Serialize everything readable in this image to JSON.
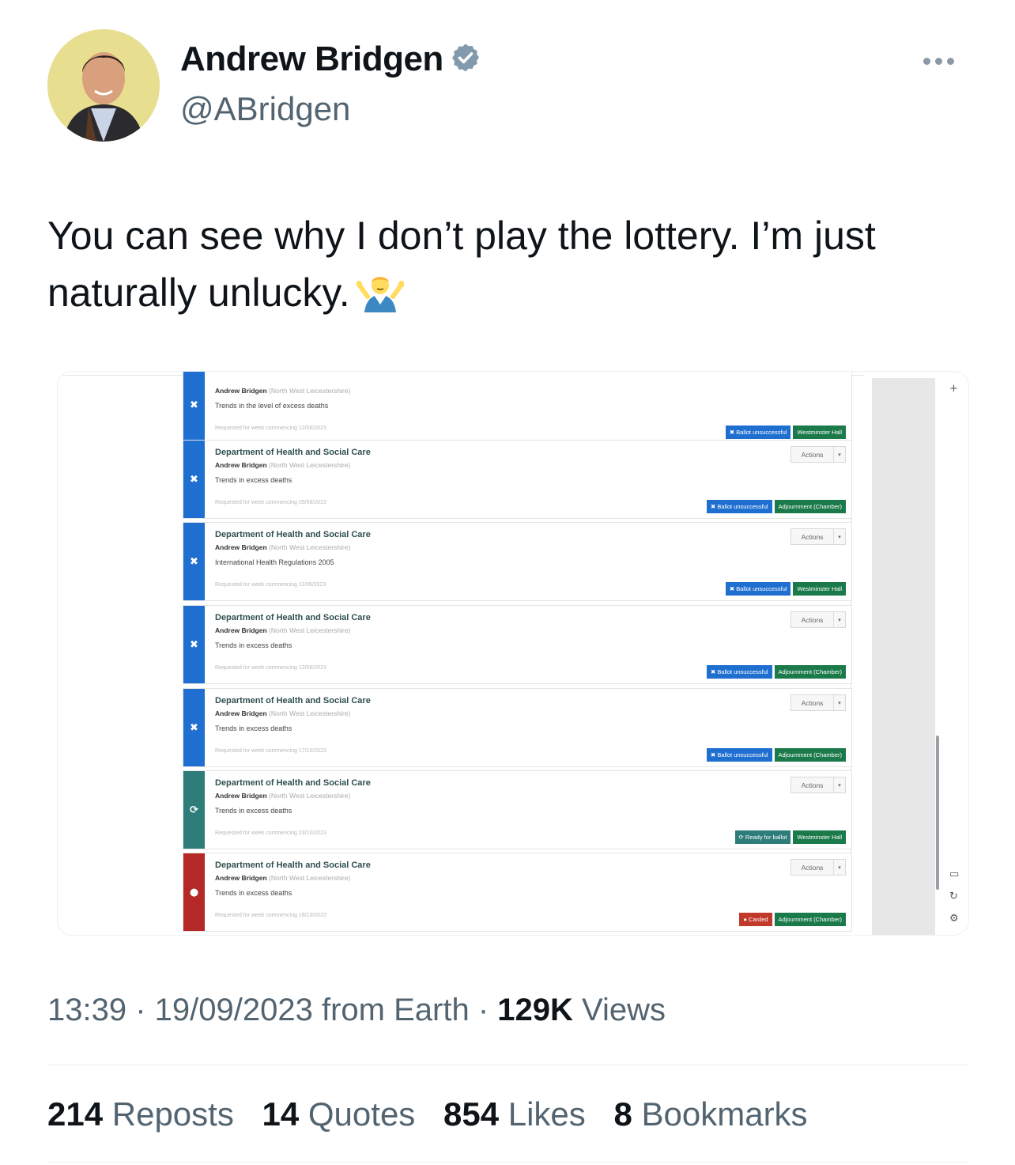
{
  "author": {
    "name": "Andrew Bridgen",
    "handle": "@ABridgen"
  },
  "tweet": {
    "text": "You can see why I don’t play the lottery. I’m just naturally unlucky."
  },
  "screenshot": {
    "cards": [
      {
        "dept": "",
        "mp": "Andrew Bridgen",
        "constituency": "(North West Leicestershire)",
        "topic": "Trends in the level of excess deaths",
        "requested": "Requested for week commencing 12/06/2023",
        "status_icon": "✖",
        "status": "Ballot unsuccessful",
        "venue": "Westminster Hall",
        "stripe_color": "#1f6fd1",
        "status_color": "#1f6fd1",
        "venue_color": "#1b7a4a",
        "actions": ""
      },
      {
        "dept": "Department of Health and Social Care",
        "mp": "Andrew Bridgen",
        "constituency": "(North West Leicestershire)",
        "topic": "Trends in excess deaths",
        "requested": "Requested for week commencing 05/06/2023",
        "status_icon": "✖",
        "status": "Ballot unsuccessful",
        "venue": "Adjournment (Chamber)",
        "stripe_color": "#1f6fd1",
        "status_color": "#1f6fd1",
        "venue_color": "#1b7a4a",
        "actions": "Actions"
      },
      {
        "dept": "Department of Health and Social Care",
        "mp": "Andrew Bridgen",
        "constituency": "(North West Leicestershire)",
        "topic": "International Health Regulations 2005",
        "requested": "Requested for week commencing 11/09/2023",
        "status_icon": "✖",
        "status": "Ballot unsuccessful",
        "venue": "Westminster Hall",
        "stripe_color": "#1f6fd1",
        "status_color": "#1f6fd1",
        "venue_color": "#1b7a4a",
        "actions": "Actions"
      },
      {
        "dept": "Department of Health and Social Care",
        "mp": "Andrew Bridgen",
        "constituency": "(North West Leicestershire)",
        "topic": "Trends in excess deaths",
        "requested": "Requested for week commencing 12/06/2023",
        "status_icon": "✖",
        "status": "Ballot unsuccessful",
        "venue": "Adjournment (Chamber)",
        "stripe_color": "#1f6fd1",
        "status_color": "#1f6fd1",
        "venue_color": "#1b7a4a",
        "actions": "Actions"
      },
      {
        "dept": "Department of Health and Social Care",
        "mp": "Andrew Bridgen",
        "constituency": "(North West Leicestershire)",
        "topic": "Trends in excess deaths",
        "requested": "Requested for week commencing 17/10/2023",
        "status_icon": "✖",
        "status": "Ballot unsuccessful",
        "venue": "Adjournment (Chamber)",
        "stripe_color": "#1f6fd1",
        "status_color": "#1f6fd1",
        "venue_color": "#1b7a4a",
        "actions": "Actions"
      },
      {
        "dept": "Department of Health and Social Care",
        "mp": "Andrew Bridgen",
        "constituency": "(North West Leicestershire)",
        "topic": "Trends in excess deaths",
        "requested": "Requested for week commencing 23/10/2023",
        "status_icon": "⟳",
        "status": "Ready for ballot",
        "venue": "Westminster Hall",
        "stripe_color": "#2f7d7a",
        "status_color": "#2f7d7a",
        "venue_color": "#1b7a4a",
        "actions": "Actions"
      },
      {
        "dept": "Department of Health and Social Care",
        "mp": "Andrew Bridgen",
        "constituency": "(North West Leicestershire)",
        "topic": "Trends in excess deaths",
        "requested": "Requested for week commencing 16/10/2023",
        "status_icon": "●",
        "status": "Carded",
        "venue": "Adjournment (Chamber)",
        "stripe_color": "#b52828",
        "status_color": "#c0392b",
        "venue_color": "#1b7a4a",
        "actions": "Actions"
      }
    ]
  },
  "meta": {
    "time": "13:39",
    "date": "19/09/2023",
    "source": "from Earth",
    "views_count": "129K",
    "views_label": "Views"
  },
  "stats": {
    "reposts_count": "214",
    "reposts_label": "Reposts",
    "quotes_count": "14",
    "quotes_label": "Quotes",
    "likes_count": "854",
    "likes_label": "Likes",
    "bookmarks_count": "8",
    "bookmarks_label": "Bookmarks"
  }
}
